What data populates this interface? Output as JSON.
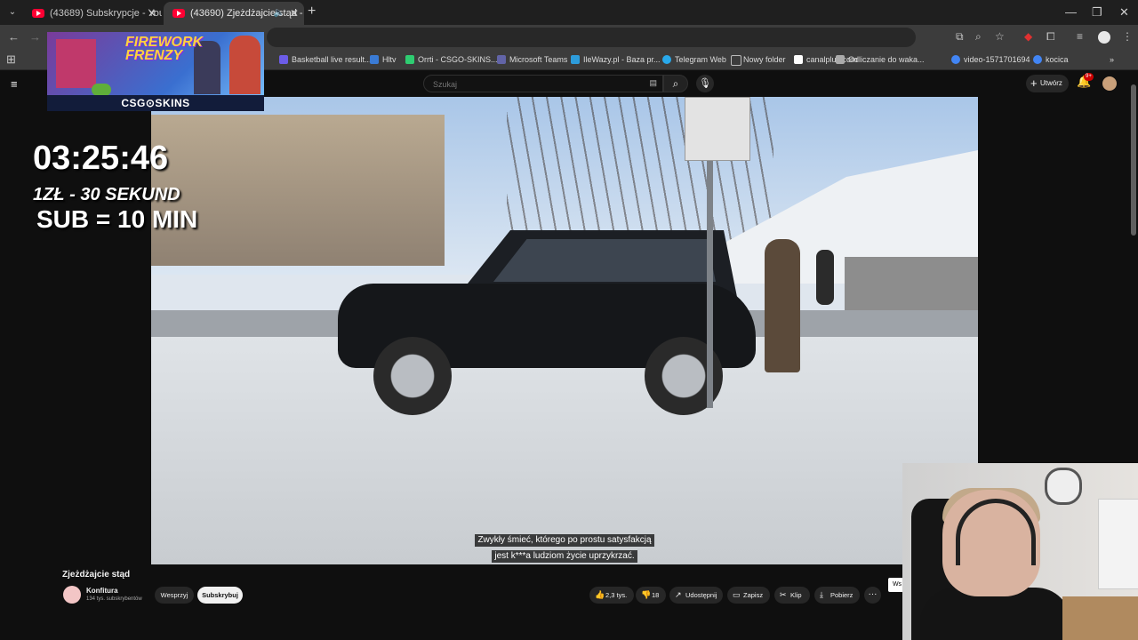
{
  "browser": {
    "tabs": [
      {
        "title": "(43689) Subskrypcje - YouTube",
        "active": false
      },
      {
        "title": "(43690) Zjeżdżajcie stąd - Y",
        "active": true
      }
    ],
    "new_tab_label": "+",
    "window_controls": {
      "minimize": "—",
      "restore": "❐",
      "close": "✕"
    },
    "bookmarks": [
      {
        "label": "Basketball live result...",
        "color": "#6c5ce7"
      },
      {
        "label": "Hltv",
        "color": "#3a7bd5"
      },
      {
        "label": "Orrti - CSGO-SKINS...",
        "color": "#2ecc71"
      },
      {
        "label": "Microsoft Teams",
        "color": "#6264a7"
      },
      {
        "label": "IleWazy.pl - Baza pr...",
        "color": "#2d9cdb"
      },
      {
        "label": "Telegram Web",
        "color": "#29a9eb"
      },
      {
        "label": "Nowy folder",
        "color": "#888888"
      },
      {
        "label": "canalplus.com",
        "color": "#ffffff"
      },
      {
        "label": "Odliczanie do waka...",
        "color": "#aaaaaa"
      },
      {
        "label": "video-1571701694",
        "color": "#4285f4"
      },
      {
        "label": "kocica",
        "color": "#4285f4"
      }
    ],
    "bookmarks_more": "»"
  },
  "youtube": {
    "search_placeholder": "Szukaj",
    "create_label": "Utwórz",
    "notifications_badge": "9+"
  },
  "overlay": {
    "banner_title": "FIREWORK FRENZY",
    "banner_brand": "CSG⊙SKINS",
    "timer": "03:25:46",
    "rate": "1ZŁ - 30 SEKUND",
    "sub_rule": "SUB = 10 MIN"
  },
  "video": {
    "captions": [
      "Zwykły śmieć, którego po prostu satysfakcją",
      "jest k***a ludziom życie uprzykrzać."
    ]
  },
  "meta": {
    "title": "Zjeżdżajcie stąd",
    "channel_name": "Konfitura",
    "channel_subs": "134 tys. subskrybentów",
    "support_label": "Wesprzyj",
    "subscribe_label": "Subskrybuj",
    "likes": "2,3 tys.",
    "dislikes": "18",
    "share_label": "Udostępnij",
    "save_label": "Zapisz",
    "clip_label": "Klip",
    "download_label": "Pobierz",
    "more_label": "···",
    "side_button": "Ws"
  }
}
